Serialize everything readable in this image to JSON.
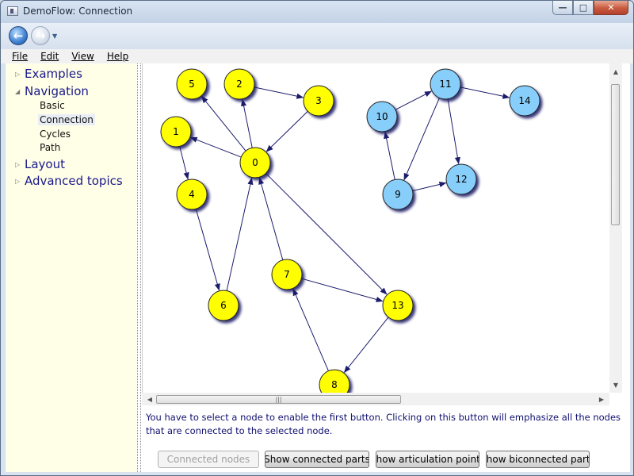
{
  "window": {
    "title": "DemoFlow: Connection"
  },
  "menu": [
    "File",
    "Edit",
    "View",
    "Help"
  ],
  "sidebar": {
    "items": [
      {
        "label": "Examples",
        "expanded": false
      },
      {
        "label": "Navigation",
        "expanded": true,
        "children": [
          {
            "label": "Basic"
          },
          {
            "label": "Connection",
            "selected": true
          },
          {
            "label": "Cycles"
          },
          {
            "label": "Path"
          }
        ]
      },
      {
        "label": "Layout",
        "expanded": false
      },
      {
        "label": "Advanced topics",
        "expanded": false
      }
    ]
  },
  "graph": {
    "colors": {
      "yellow": "#ffff00",
      "blue": "#87cefa",
      "edge": "#1c1c6c"
    },
    "nodes": [
      {
        "id": "0",
        "color": "yellow"
      },
      {
        "id": "1",
        "color": "yellow"
      },
      {
        "id": "2",
        "color": "yellow"
      },
      {
        "id": "3",
        "color": "yellow"
      },
      {
        "id": "4",
        "color": "yellow"
      },
      {
        "id": "5",
        "color": "yellow"
      },
      {
        "id": "6",
        "color": "yellow"
      },
      {
        "id": "7",
        "color": "yellow"
      },
      {
        "id": "8",
        "color": "yellow"
      },
      {
        "id": "9",
        "color": "blue"
      },
      {
        "id": "10",
        "color": "blue"
      },
      {
        "id": "11",
        "color": "blue"
      },
      {
        "id": "12",
        "color": "blue"
      },
      {
        "id": "13",
        "color": "yellow"
      },
      {
        "id": "14",
        "color": "blue"
      }
    ],
    "edges": [
      [
        "2",
        "3"
      ],
      [
        "3",
        "0"
      ],
      [
        "0",
        "2"
      ],
      [
        "0",
        "5"
      ],
      [
        "0",
        "1"
      ],
      [
        "1",
        "4"
      ],
      [
        "4",
        "6"
      ],
      [
        "6",
        "0"
      ],
      [
        "7",
        "0"
      ],
      [
        "0",
        "13"
      ],
      [
        "7",
        "13"
      ],
      [
        "13",
        "8"
      ],
      [
        "8",
        "7"
      ],
      [
        "10",
        "11"
      ],
      [
        "11",
        "14"
      ],
      [
        "11",
        "9"
      ],
      [
        "11",
        "12"
      ],
      [
        "9",
        "10"
      ],
      [
        "9",
        "12"
      ]
    ]
  },
  "description": "You have to select a node to enable the first button. Clicking on this button will emphasize all the nodes that are connected to the selected node.",
  "buttons": [
    {
      "label": "Connected nodes",
      "enabled": false
    },
    {
      "label": "Show connected parts",
      "enabled": true
    },
    {
      "label": "Show articulation points",
      "enabled": true
    },
    {
      "label": "Show biconnected parts",
      "enabled": true
    }
  ]
}
